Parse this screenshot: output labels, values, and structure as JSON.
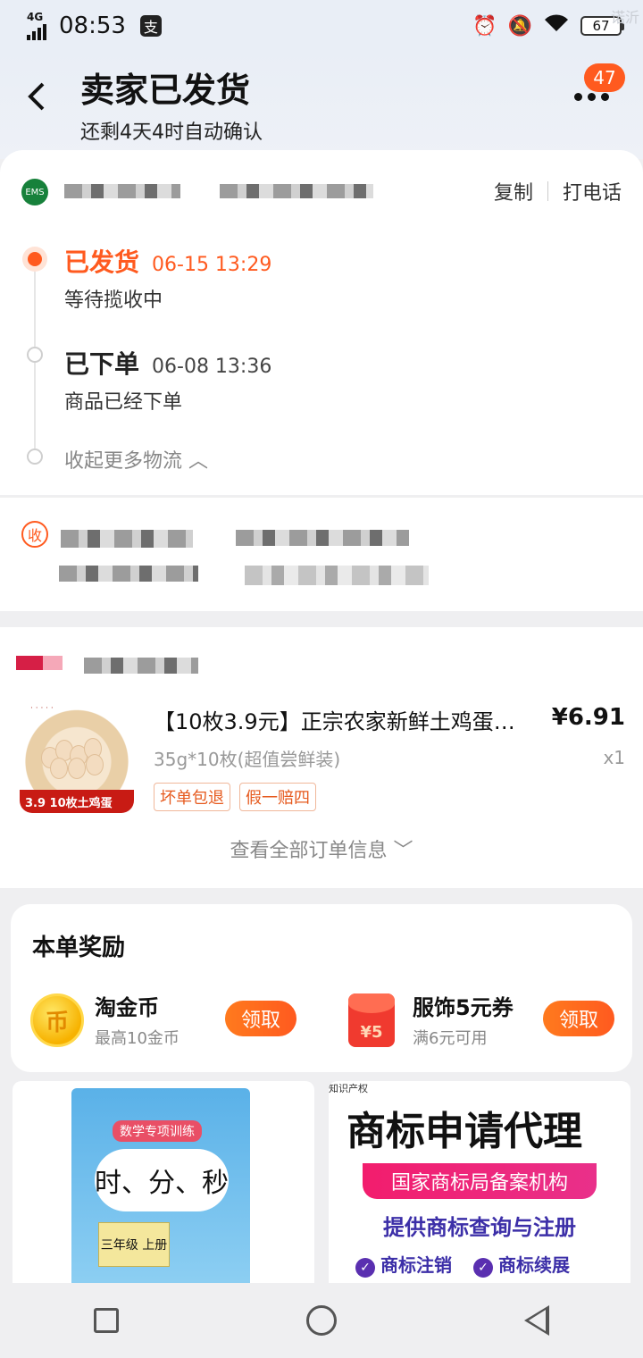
{
  "status_bar": {
    "network": "4G",
    "time": "08:53",
    "battery": "67",
    "watermark": "诺沂"
  },
  "header": {
    "title": "卖家已发货",
    "subtitle": "还剩4天4时自动确认",
    "badge": "47"
  },
  "logistics": {
    "actions": [
      "复制",
      "打电话"
    ],
    "events": [
      {
        "status": "已发货",
        "time": "06-15 13:29",
        "desc": "等待揽收中"
      },
      {
        "status": "已下单",
        "time": "06-08 13:36",
        "desc": "商品已经下单"
      }
    ],
    "collapse": "收起更多物流"
  },
  "address": {
    "label": "收"
  },
  "order": {
    "product": {
      "title": "【10枚3.9元】正宗农家新鲜土鸡蛋…",
      "price": "¥6.91",
      "spec": "35g*10枚(超值尝鲜装)",
      "qty": "x1",
      "tags": [
        "坏单包退",
        "假一赔四"
      ],
      "thumb_promo": "3.9  10枚土鸡蛋"
    },
    "see_all": "查看全部订单信息"
  },
  "rewards": {
    "title": "本单奖励",
    "items": [
      {
        "name": "淘金币",
        "sub": "最高10金币",
        "button": "领取",
        "icon": "coin-icon"
      },
      {
        "name": "服饰5元券",
        "sub": "满6元可用",
        "button": "领取",
        "icon": "red-packet-icon"
      }
    ]
  },
  "feed": {
    "book": {
      "title": "时、分、秒",
      "label": "数学专项训练",
      "grade": "三年级 上册"
    },
    "trademark": {
      "small": "知识产权",
      "head": "商标申请代理",
      "bar": "国家商标局备案机构",
      "line1": "提供商标查询与注册",
      "line2a": "商标注销",
      "line2b": "商标续展"
    }
  }
}
